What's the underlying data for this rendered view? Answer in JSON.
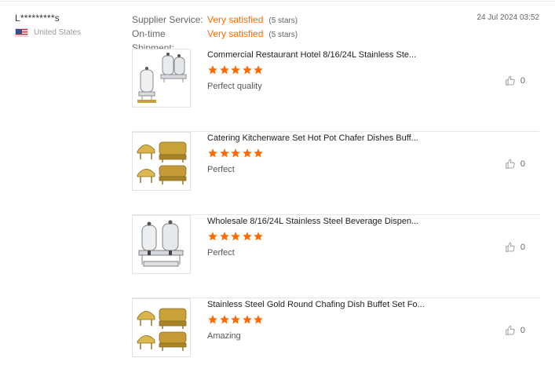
{
  "reviewer": {
    "name": "L*********s",
    "country": "United States",
    "flag_icon": "us-flag-icon"
  },
  "ratings": [
    {
      "label": "Supplier Service:",
      "value": "Very satisfied",
      "stars": "(5 stars)"
    },
    {
      "label": "On-time Shipment:",
      "value": "Very satisfied",
      "stars": "(5 stars)"
    }
  ],
  "date": "24 Jul 2024 03:52",
  "colors": {
    "accent": "#ff6a00",
    "divider": "#e6e6e6",
    "gold": "#c9a23a"
  },
  "items": [
    {
      "title": "Commercial Restaurant Hotel 8/16/24L Stainless Ste...",
      "rating": 5,
      "comment": "Perfect quality",
      "helpful_count": "0",
      "image": "beverage-dispenser-triple"
    },
    {
      "title": "Catering Kitchenware Set Hot Pot Chafer Dishes Buff...",
      "rating": 5,
      "comment": "Perfect",
      "helpful_count": "0",
      "image": "gold-chafing-dish-set"
    },
    {
      "title": "Wholesale 8/16/24L Stainless Steel Beverage Dispen...",
      "rating": 5,
      "comment": "Perfect",
      "helpful_count": "0",
      "image": "beverage-dispenser-double"
    },
    {
      "title": "Stainless Steel Gold Round Chafing Dish Buffet Set Fo...",
      "rating": 5,
      "comment": "Amazing",
      "helpful_count": "0",
      "image": "gold-chafing-dish-set"
    }
  ]
}
